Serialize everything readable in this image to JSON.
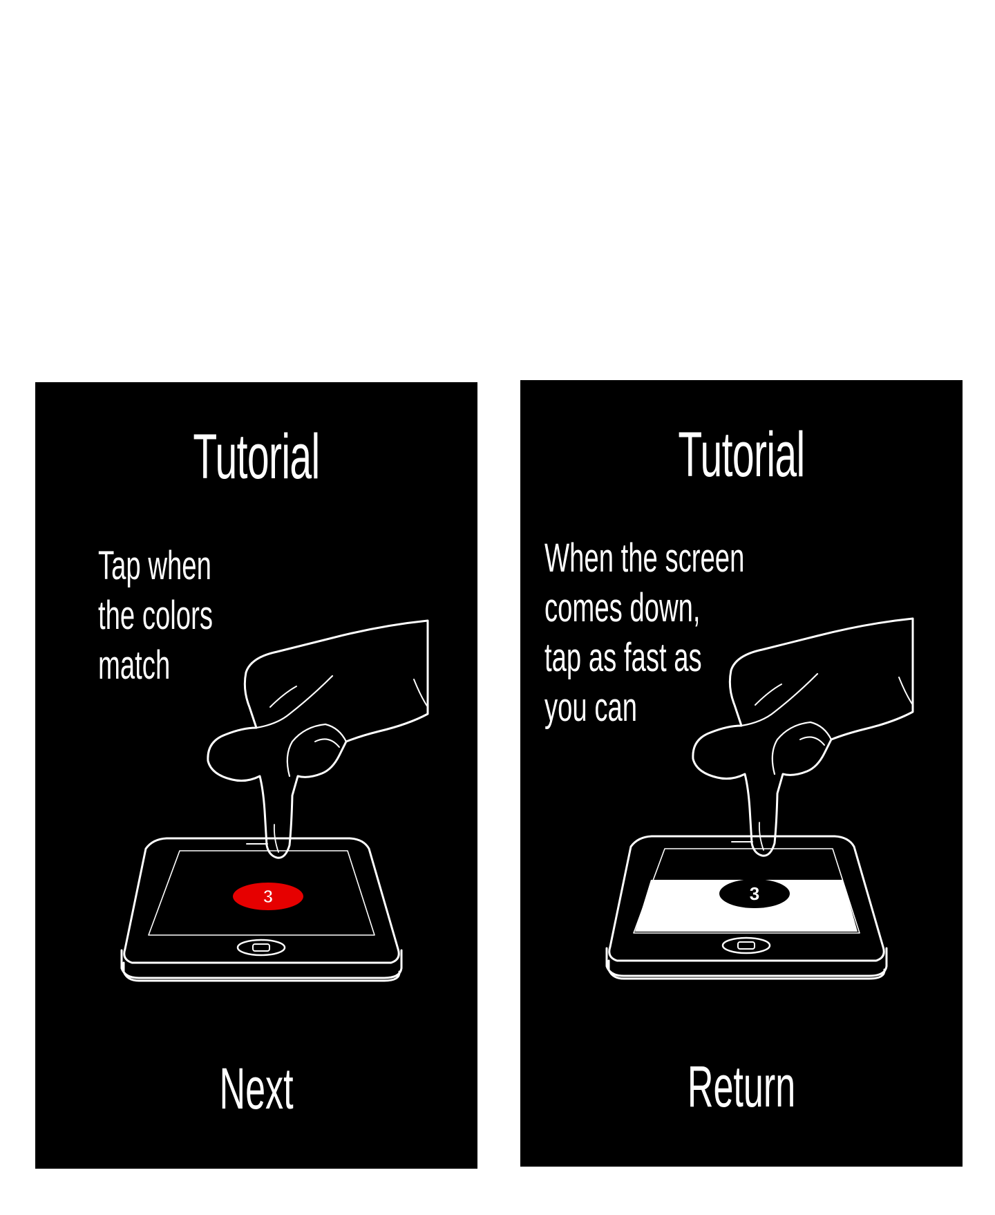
{
  "screens": [
    {
      "title": "Tutorial",
      "instruction": "Tap when\nthe colors\nmatch",
      "button_label": "Next",
      "badge_number": "3",
      "badge_color": "#e60000",
      "screen_state": "dark"
    },
    {
      "title": "Tutorial",
      "instruction": "When the screen\ncomes down,\ntap as fast as\nyou can",
      "button_label": "Return",
      "badge_number": "3",
      "badge_color": "#000000",
      "screen_state": "lowered-white"
    }
  ],
  "colors": {
    "background": "#000000",
    "text": "#ffffff",
    "page": "#ffffff"
  }
}
